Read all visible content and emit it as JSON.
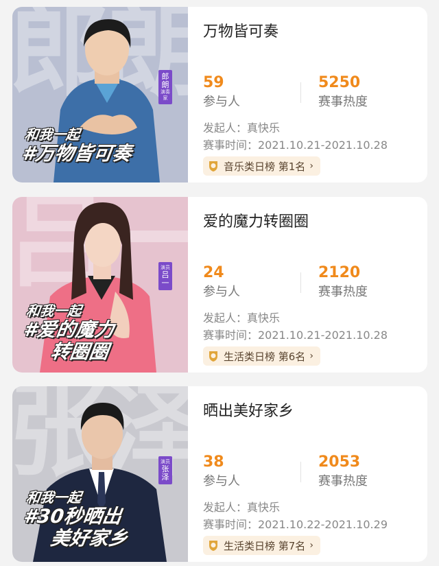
{
  "cards": [
    {
      "cover": {
        "bg_text": "郎朗",
        "name": "郎朗",
        "role": "演奏家",
        "slogan_1": "和我一起",
        "slogan_2": "#万物皆可奏",
        "slogan_3": "",
        "bg_color": "#b9bfd2"
      },
      "title": "万物皆可奏",
      "participants": "59",
      "participants_label": "参与人",
      "heat": "5250",
      "heat_label": "赛事热度",
      "initiator": "发起人：真快乐",
      "time": "赛事时间：2021.10.21-2021.10.28",
      "rank": "音乐类日榜 第1名"
    },
    {
      "cover": {
        "bg_text": "吕一",
        "name": "吕一",
        "role": "演员",
        "slogan_1": "和我一起",
        "slogan_2": "#爱的魔力",
        "slogan_3": "转圈圈",
        "bg_color": "#e6c3cf"
      },
      "title": "爱的魔力转圈圈",
      "participants": "24",
      "participants_label": "参与人",
      "heat": "2120",
      "heat_label": "赛事热度",
      "initiator": "发起人：真快乐",
      "time": "赛事时间：2021.10.21-2021.10.28",
      "rank": "生活类日榜 第6名"
    },
    {
      "cover": {
        "bg_text": "张泽",
        "name": "张泽",
        "role": "演员",
        "slogan_1": "和我一起",
        "slogan_2": "#30秒晒出",
        "slogan_3": "美好家乡",
        "bg_color": "#c9c9cf"
      },
      "title": "晒出美好家乡",
      "participants": "38",
      "participants_label": "参与人",
      "heat": "2053",
      "heat_label": "赛事热度",
      "initiator": "发起人：真快乐",
      "time": "赛事时间：2021.10.22-2021.10.29",
      "rank": "生活类日榜 第7名"
    }
  ],
  "colors": {
    "accent": "#f08a1c",
    "rank_bg": "#fbf0e1",
    "tag": "#7b4bc9"
  },
  "icons": {
    "rank": "medal-icon",
    "more": "chevron-right-icon"
  }
}
